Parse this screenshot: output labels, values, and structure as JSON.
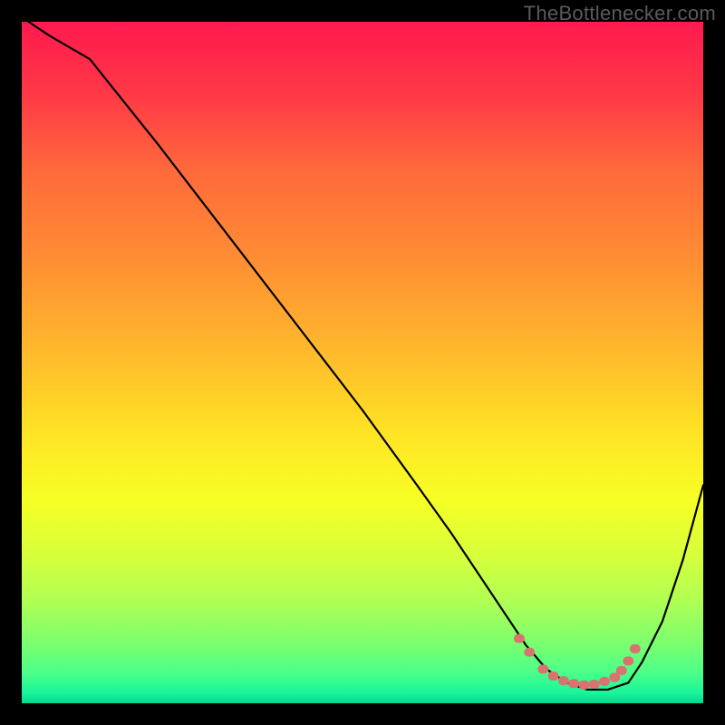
{
  "attribution": "TheBottlenecker.com",
  "gradient": {
    "stops": [
      {
        "o": 0.0,
        "c": "#ff1a4f"
      },
      {
        "o": 0.1,
        "c": "#ff3647"
      },
      {
        "o": 0.22,
        "c": "#ff6a3b"
      },
      {
        "o": 0.35,
        "c": "#ff8e34"
      },
      {
        "o": 0.48,
        "c": "#ffb82c"
      },
      {
        "o": 0.6,
        "c": "#ffe225"
      },
      {
        "o": 0.7,
        "c": "#f7ff25"
      },
      {
        "o": 0.78,
        "c": "#d8ff3a"
      },
      {
        "o": 0.85,
        "c": "#b0ff54"
      },
      {
        "o": 0.91,
        "c": "#7dff6e"
      },
      {
        "o": 0.955,
        "c": "#4cff88"
      },
      {
        "o": 0.985,
        "c": "#18f59a"
      },
      {
        "o": 1.0,
        "c": "#00d88e"
      }
    ]
  },
  "marker_color": "#d8736f",
  "curve_color": "#000000",
  "chart_data": {
    "type": "line",
    "title": "",
    "xlabel": "",
    "ylabel": "",
    "x_range": [
      0,
      100
    ],
    "y_range": [
      0,
      100
    ],
    "curve": {
      "x": [
        1,
        4,
        10,
        20,
        30,
        40,
        50,
        58,
        63,
        67,
        71,
        74,
        77,
        80,
        83,
        86,
        89,
        91,
        94,
        97,
        100
      ],
      "y": [
        100,
        98,
        94.5,
        82,
        69,
        56,
        43,
        32,
        25,
        19,
        13,
        8.5,
        5,
        3,
        2,
        2,
        3,
        6,
        12,
        21,
        32
      ]
    },
    "highlight_points": {
      "x": [
        73,
        74.5,
        76.5,
        78,
        79.5,
        81,
        82.5,
        84,
        85.5,
        87,
        88,
        89,
        90
      ],
      "y": [
        9.5,
        7.5,
        5,
        4,
        3.3,
        2.9,
        2.7,
        2.8,
        3.2,
        3.8,
        4.8,
        6.2,
        8
      ]
    }
  }
}
